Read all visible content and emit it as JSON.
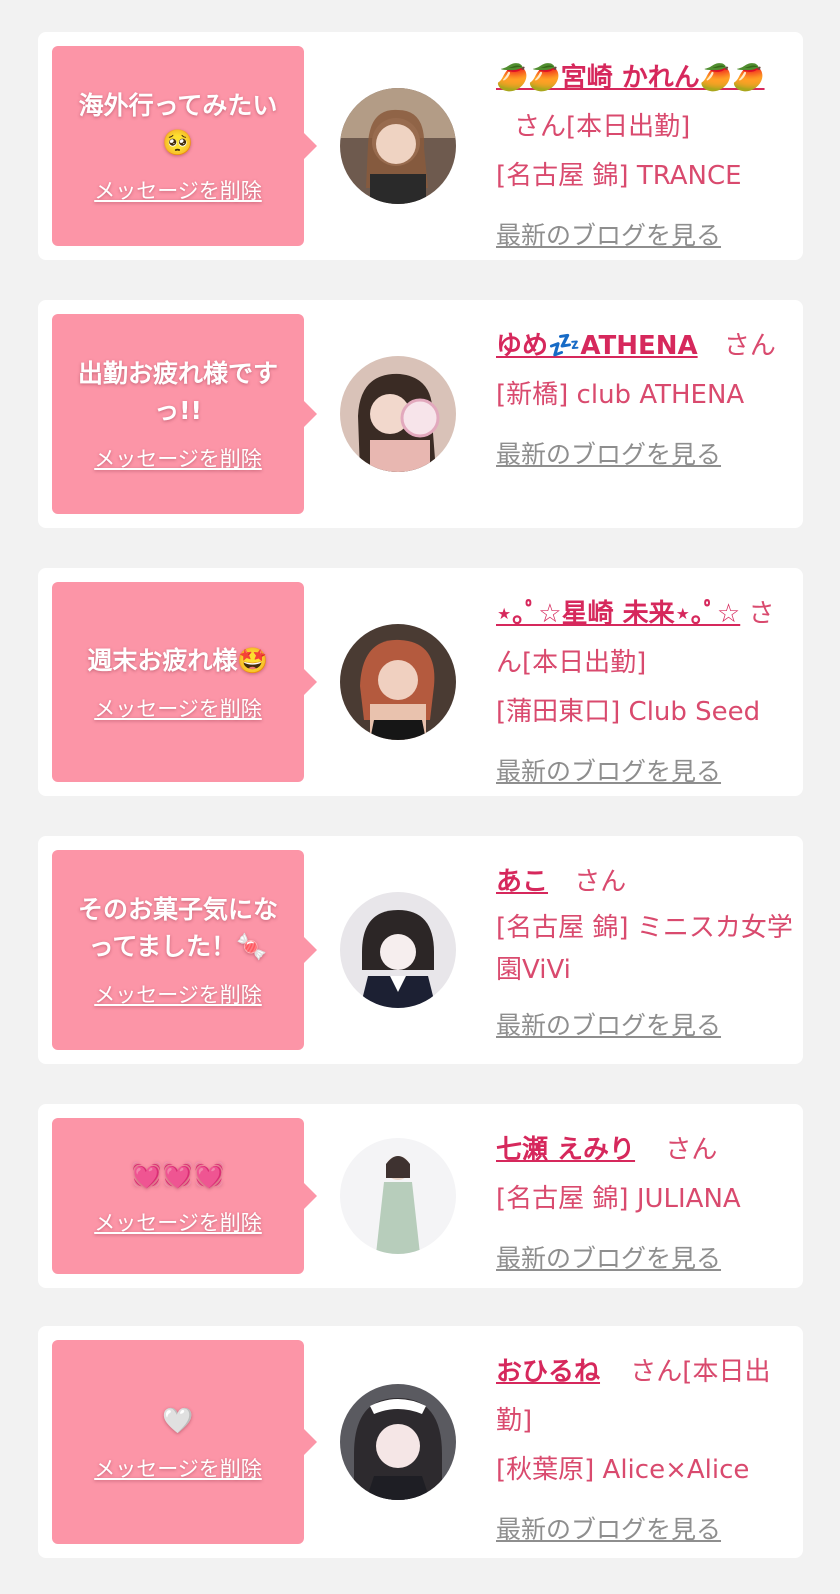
{
  "delete_label": "メッセージを削除",
  "blog_label": "最新のブログを見る",
  "san_label": "さん",
  "cards": [
    {
      "message": "海外行ってみたい🥺",
      "name": "🥭🥭宮崎 かれん🥭🥭",
      "status": "[本日出勤]",
      "shop": "[名古屋 錦] TRANCE",
      "avatar_icon": "cast-avatar"
    },
    {
      "message": "出勤お疲れ様ですっ!!",
      "name": "ゆめ💤ATHENA",
      "status": "",
      "shop": "[新橋] club ATHENA",
      "avatar_icon": "cast-avatar"
    },
    {
      "message": "週末お疲れ様🤩",
      "name": "⋆｡ﾟ☆星崎 未来⋆｡ﾟ☆",
      "status": "[本日出勤]",
      "shop": "[蒲田東口] Club Seed",
      "avatar_icon": "cast-avatar"
    },
    {
      "message": "そのお菓子気になってました！🍬",
      "name": "あこ",
      "status": "",
      "shop": "[名古屋 錦] ミニスカ女学園ViVi",
      "avatar_icon": "cast-avatar"
    },
    {
      "message": "💓💓💓",
      "name": "七瀬 えみり",
      "status": "",
      "shop": "[名古屋 錦] JULIANA",
      "avatar_icon": "cast-avatar"
    },
    {
      "message": "🤍",
      "name": "おひるね",
      "status": "[本日出勤]",
      "shop": "[秋葉原] Alice×Alice",
      "avatar_icon": "cast-avatar"
    }
  ],
  "colors": {
    "bubble": "#fc95a7",
    "name": "#d6285c",
    "shop_text": "#d94a6e",
    "blog_link": "#8e8e8e",
    "background": "#f2f2f2"
  }
}
